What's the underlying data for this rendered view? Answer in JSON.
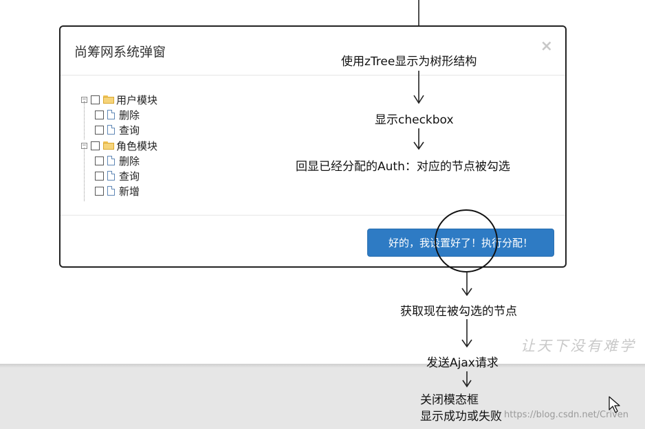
{
  "modal": {
    "title": "尚筹网系统弹窗",
    "close_label": "×",
    "confirm_button_label": "好的，我设置好了！执行分配！"
  },
  "tree": {
    "nodes": [
      {
        "label": "用户模块",
        "type": "folder",
        "level": 0,
        "expanded": true,
        "checked": false
      },
      {
        "label": "删除",
        "type": "file",
        "level": 1,
        "checked": false
      },
      {
        "label": "查询",
        "type": "file",
        "level": 1,
        "checked": false
      },
      {
        "label": "角色模块",
        "type": "folder",
        "level": 0,
        "expanded": true,
        "checked": false
      },
      {
        "label": "删除",
        "type": "file",
        "level": 1,
        "checked": false
      },
      {
        "label": "查询",
        "type": "file",
        "level": 1,
        "checked": false
      },
      {
        "label": "新增",
        "type": "file",
        "level": 1,
        "checked": false
      }
    ],
    "toggle_symbol": "−"
  },
  "flow": {
    "step1": "使用zTree显示为树形结构",
    "step2": "显示checkbox",
    "step3": "回显已经分配的Auth：对应的节点被勾选",
    "step4": "获取现在被勾选的节点",
    "step5": "发送Ajax请求",
    "step6_line1": "关闭模态框",
    "step6_line2": "显示成功或失败"
  },
  "watermark": "让天下没有难学",
  "source_url": "https://blog.csdn.net/Criven",
  "colors": {
    "button_bg": "#2e7bc4",
    "folder": "#f6d47a",
    "bottom_band": "#e6e6e6"
  },
  "icons": [
    "minus-toggle-icon",
    "checkbox-icon",
    "folder-icon",
    "file-icon",
    "close-icon",
    "arrow-down-icon",
    "mouse-cursor-icon"
  ]
}
